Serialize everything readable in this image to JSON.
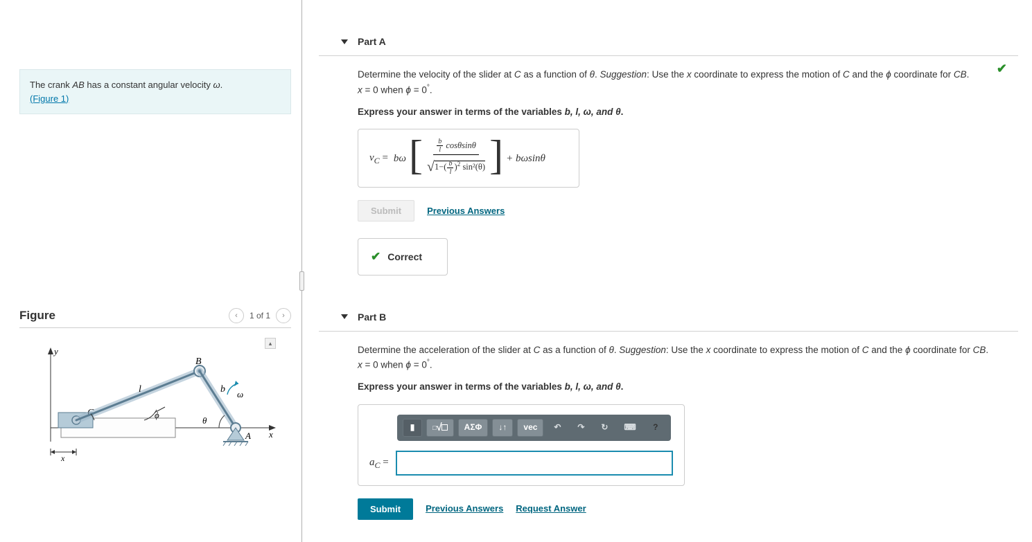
{
  "problem": {
    "text_pre": "The crank ",
    "ab": "AB",
    "text_mid": " has a constant angular velocity ",
    "omega": "ω",
    "text_post": ".",
    "figure_link": "(Figure 1)"
  },
  "figure": {
    "title": "Figure",
    "pager": "1 of 1",
    "labels": {
      "y": "y",
      "x": "x",
      "B": "B",
      "C": "C",
      "A": "A",
      "l": "l",
      "b": "b",
      "theta": "θ",
      "phi": "ϕ",
      "omega": "ω",
      "xdim": "x"
    }
  },
  "partA": {
    "title": "Part A",
    "prompt_1": "Determine the velocity of the slider at ",
    "C": "C",
    "prompt_2": " as a function of ",
    "theta": "θ",
    "prompt_3": ". ",
    "sugg_label": "Suggestion",
    "sugg_text": ": Use the ",
    "x": "x",
    "sugg_text2": " coordinate to express the motion of ",
    "sugg_text3": " and the ",
    "phi": "ϕ",
    "sugg_text4": " coordinate for ",
    "CB": "CB",
    "sugg_text5": ". ",
    "cond": "x = 0 when ϕ = 0°.",
    "instr_pre": "Express your answer in terms of the variables ",
    "vars": "b, l, ω, and θ",
    "instr_post": ".",
    "lhs": "v",
    "lhs_sub": "C",
    "eq": " = ",
    "term1": "bω",
    "num_pre": " cosθsinθ",
    "den_under": "sin²(θ)",
    "term2": " + bωsinθ",
    "submit": "Submit",
    "prev": "Previous Answers",
    "feedback": "Correct"
  },
  "partB": {
    "title": "Part B",
    "prompt_1": "Determine the acceleration of the slider at ",
    "C": "C",
    "prompt_2": " as a function of ",
    "theta": "θ",
    "prompt_3": ". ",
    "sugg_label": "Suggestion",
    "sugg_text": ": Use the ",
    "x": "x",
    "sugg_text2": " coordinate to express the motion of ",
    "sugg_text3": " and the ",
    "phi": "ϕ",
    "sugg_text4": " coordinate for ",
    "CB": "CB",
    "sugg_text5": ". ",
    "cond": "x = 0 when ϕ = 0°.",
    "instr_pre": "Express your answer in terms of the variables ",
    "vars": "b, l, ω, and θ",
    "instr_post": ".",
    "toolbar": {
      "templates": "▮",
      "root_frac": "√x",
      "x_sub": "x̲",
      "greek": "ΑΣΦ",
      "updown": "↓↑",
      "vec": "vec",
      "undo": "↶",
      "redo": "↷",
      "reset": "↻",
      "keyboard": "⌨",
      "help": "?"
    },
    "lhs": "a",
    "lhs_sub": "C",
    "eq": " = ",
    "input_value": "",
    "submit": "Submit",
    "prev": "Previous Answers",
    "req": "Request Answer"
  }
}
